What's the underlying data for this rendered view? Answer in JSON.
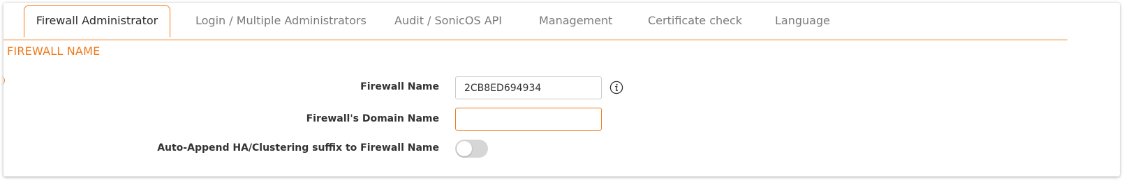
{
  "tabs": [
    {
      "label": "Firewall Administrator",
      "active": true
    },
    {
      "label": "Login / Multiple Administrators",
      "active": false
    },
    {
      "label": "Audit / SonicOS API",
      "active": false
    },
    {
      "label": "Management",
      "active": false
    },
    {
      "label": "Certificate check",
      "active": false
    },
    {
      "label": "Language",
      "active": false
    }
  ],
  "section": {
    "title": "FIREWALL NAME"
  },
  "form": {
    "firewall_name": {
      "label": "Firewall Name",
      "value": "2CB8ED694934",
      "info_icon": "info-icon"
    },
    "domain_name": {
      "label": "Firewall's Domain Name",
      "value": ""
    },
    "auto_append": {
      "label": "Auto-Append HA/Clustering suffix to Firewall Name",
      "enabled": false
    }
  },
  "colors": {
    "accent": "#f07a1a",
    "tab_inactive_text": "#7a7a7a",
    "toggle_off": "#d6d6d6"
  }
}
